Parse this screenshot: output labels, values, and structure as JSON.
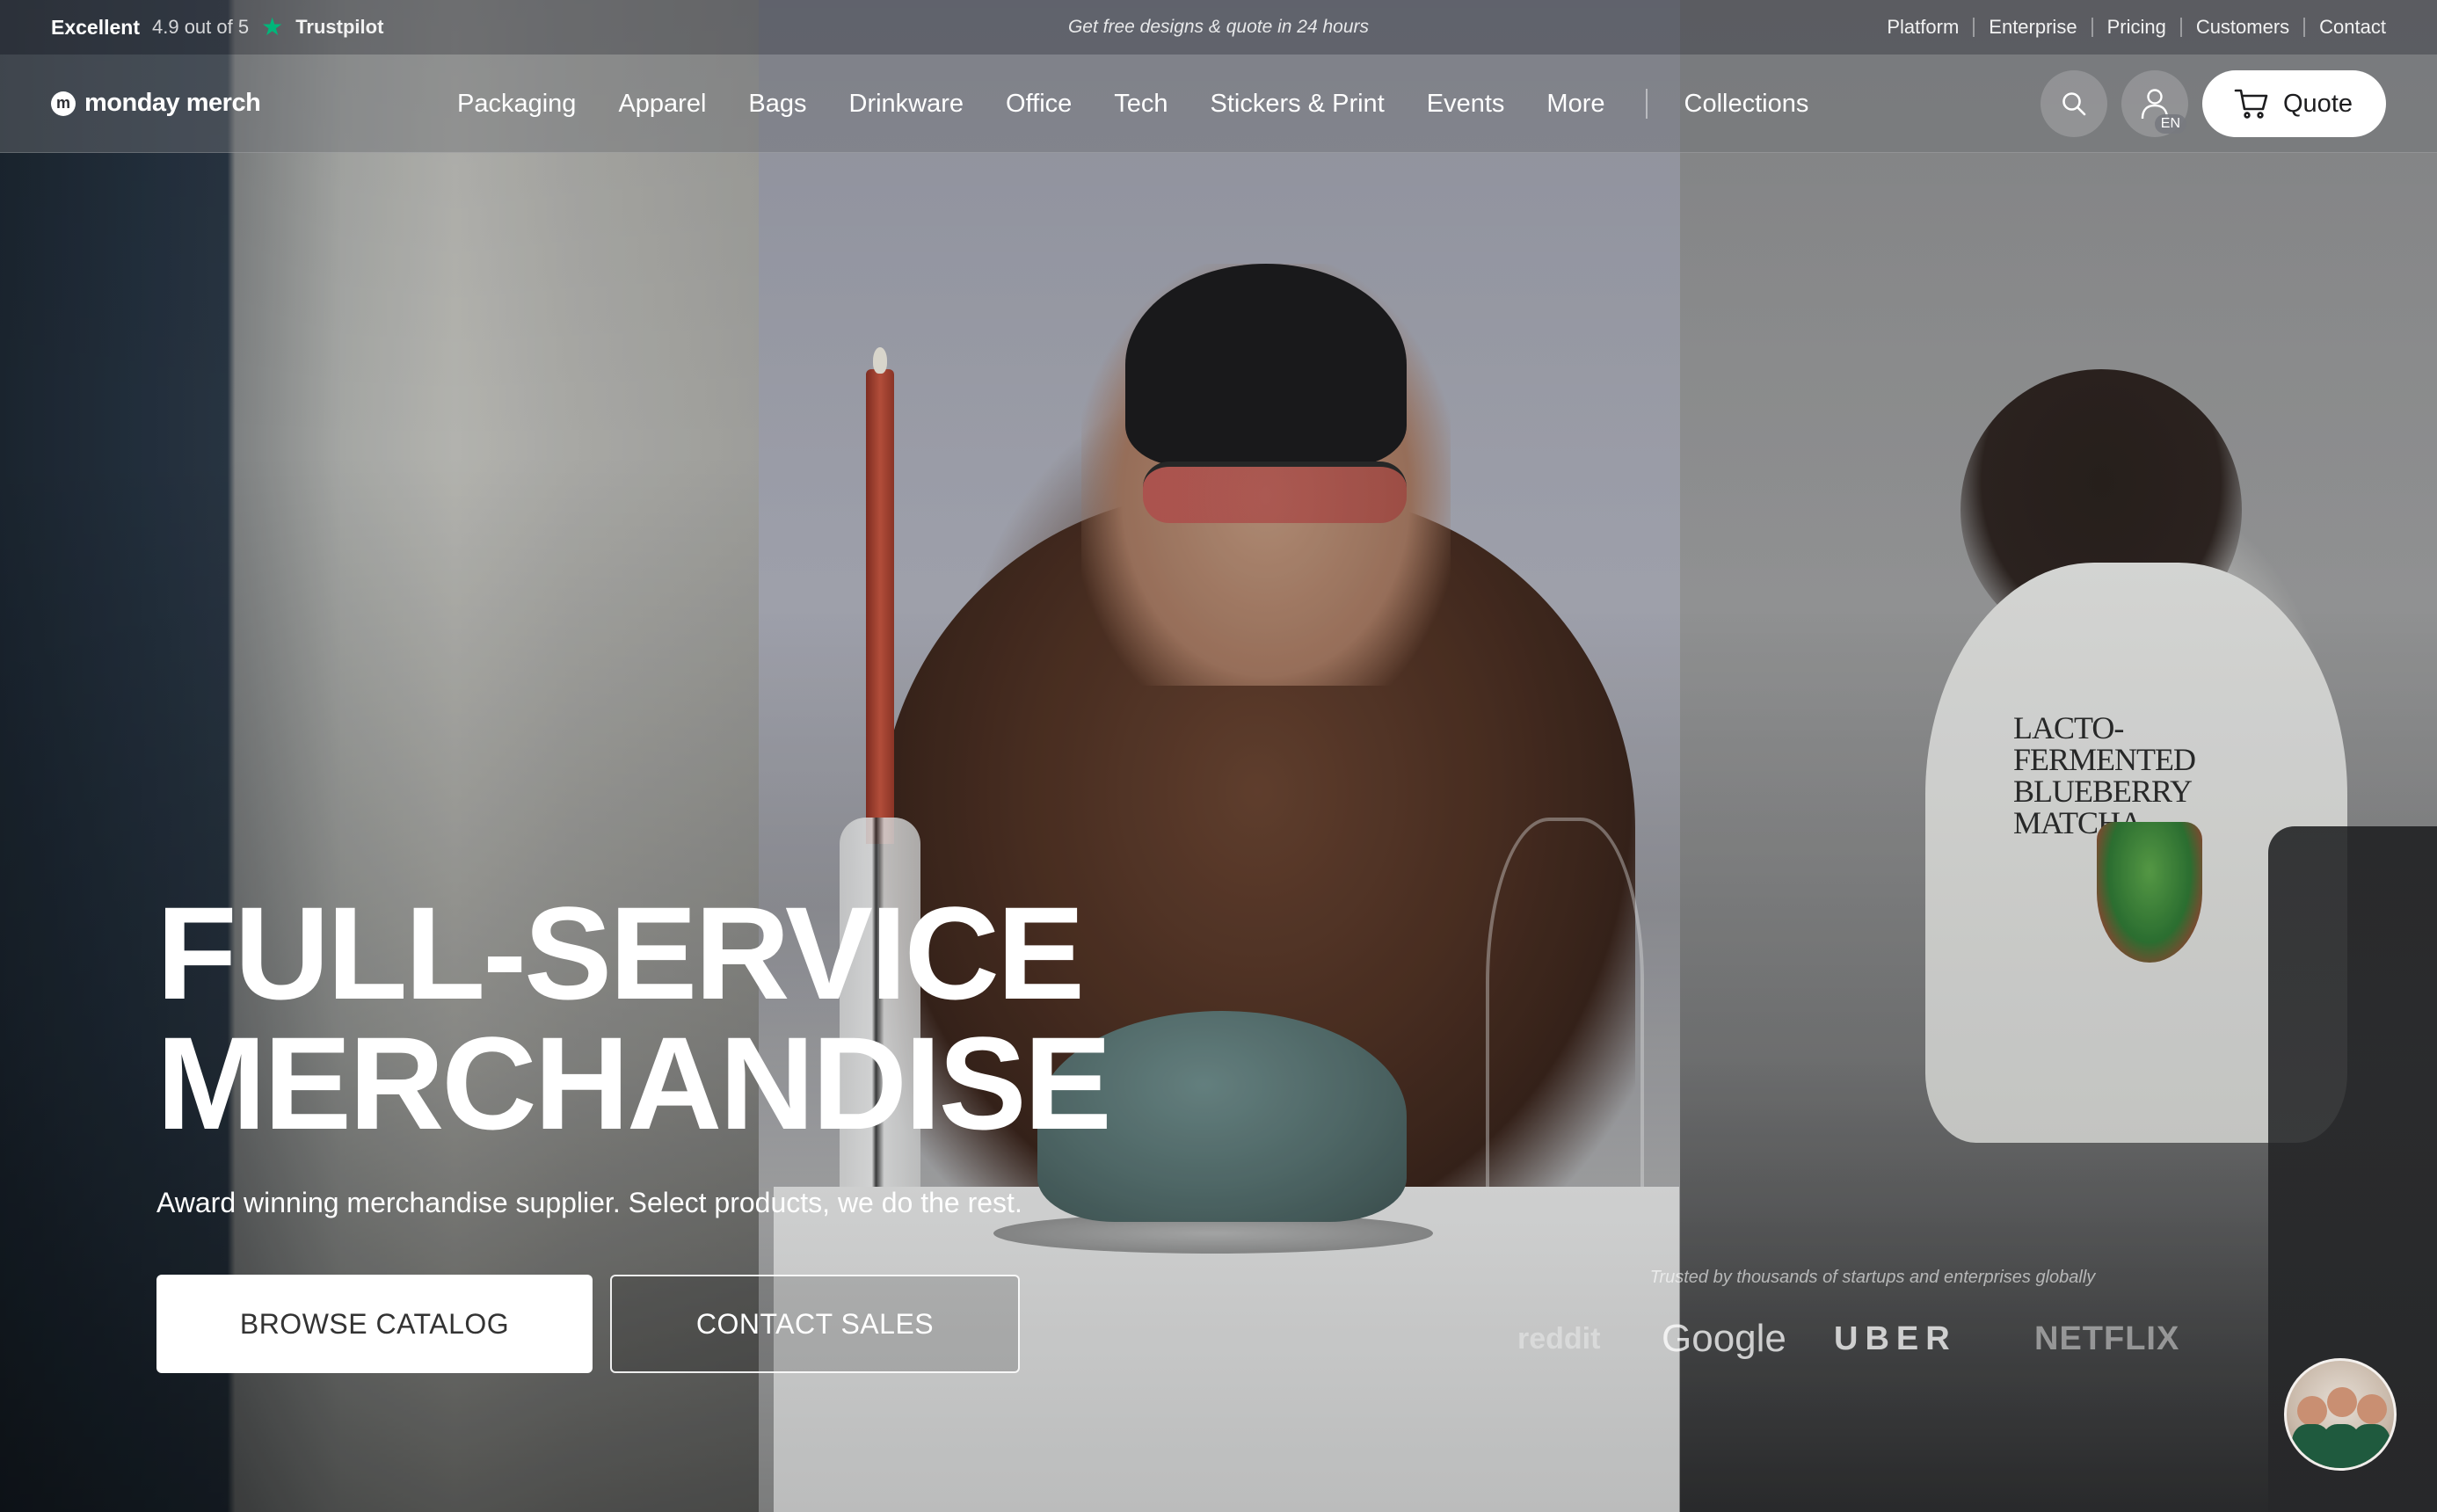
{
  "topbar": {
    "rating_word": "Excellent",
    "rating_text": "4.9 out of 5",
    "trust_brand": "Trustpilot",
    "promo": "Get free designs & quote in 24 hours",
    "links": [
      "Platform",
      "Enterprise",
      "Pricing",
      "Customers",
      "Contact"
    ]
  },
  "nav": {
    "logo_text": "monday merch",
    "logo_mark": "m",
    "items": [
      "Packaging",
      "Apparel",
      "Bags",
      "Drinkware",
      "Office",
      "Tech",
      "Stickers & Print",
      "Events",
      "More"
    ],
    "collections": "Collections",
    "lang": "EN",
    "quote": "Quote"
  },
  "hero": {
    "headline_line1": "FULL-SERVICE",
    "headline_line2": "MERCHANDISE",
    "subhead": "Award winning merchandise supplier. Select products, we do the rest.",
    "primary_cta": "BROWSE CATALOG",
    "secondary_cta": "CONTACT SALES",
    "tshirt_text": "LACTO-FERMENTED BLUEBERRY MATCHA"
  },
  "trusted": {
    "caption": "Trusted by thousands of startups and enterprises globally",
    "brands": [
      "reddit",
      "Google",
      "UBER",
      "NETFLIX"
    ]
  },
  "colors": {
    "trustpilot_star": "#00b67a",
    "button_bg": "#ffffff"
  },
  "icons": {
    "search": "search-icon",
    "account": "user-icon",
    "cart": "cart-icon",
    "star": "star-icon"
  }
}
